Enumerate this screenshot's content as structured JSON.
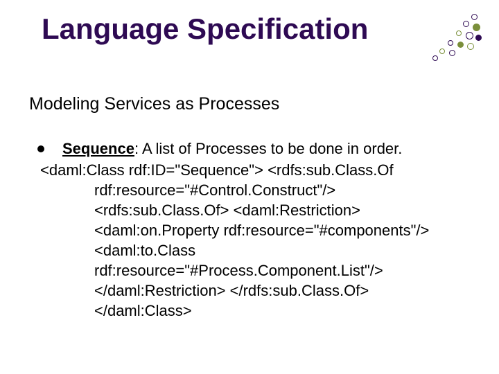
{
  "title": "Language Specification",
  "subtitle": "Modeling Services as Processes",
  "bullet": {
    "label": "Sequence",
    "desc": ": A list of Processes to be done in order."
  },
  "code": {
    "l1": "<daml:Class rdf:ID=\"Sequence\"> <rdfs:sub.Class.Of",
    "l2": "rdf:resource=\"#Control.Construct\"/>",
    "l3": "<rdfs:sub.Class.Of> <daml:Restriction>",
    "l4": "<daml:on.Property rdf:resource=\"#components\"/>",
    "l5": "<daml:to.Class",
    "l6": "rdf:resource=\"#Process.Component.List\"/>",
    "l7": "</daml:Restriction> </rdfs:sub.Class.Of>",
    "l8": "</daml:Class>"
  }
}
